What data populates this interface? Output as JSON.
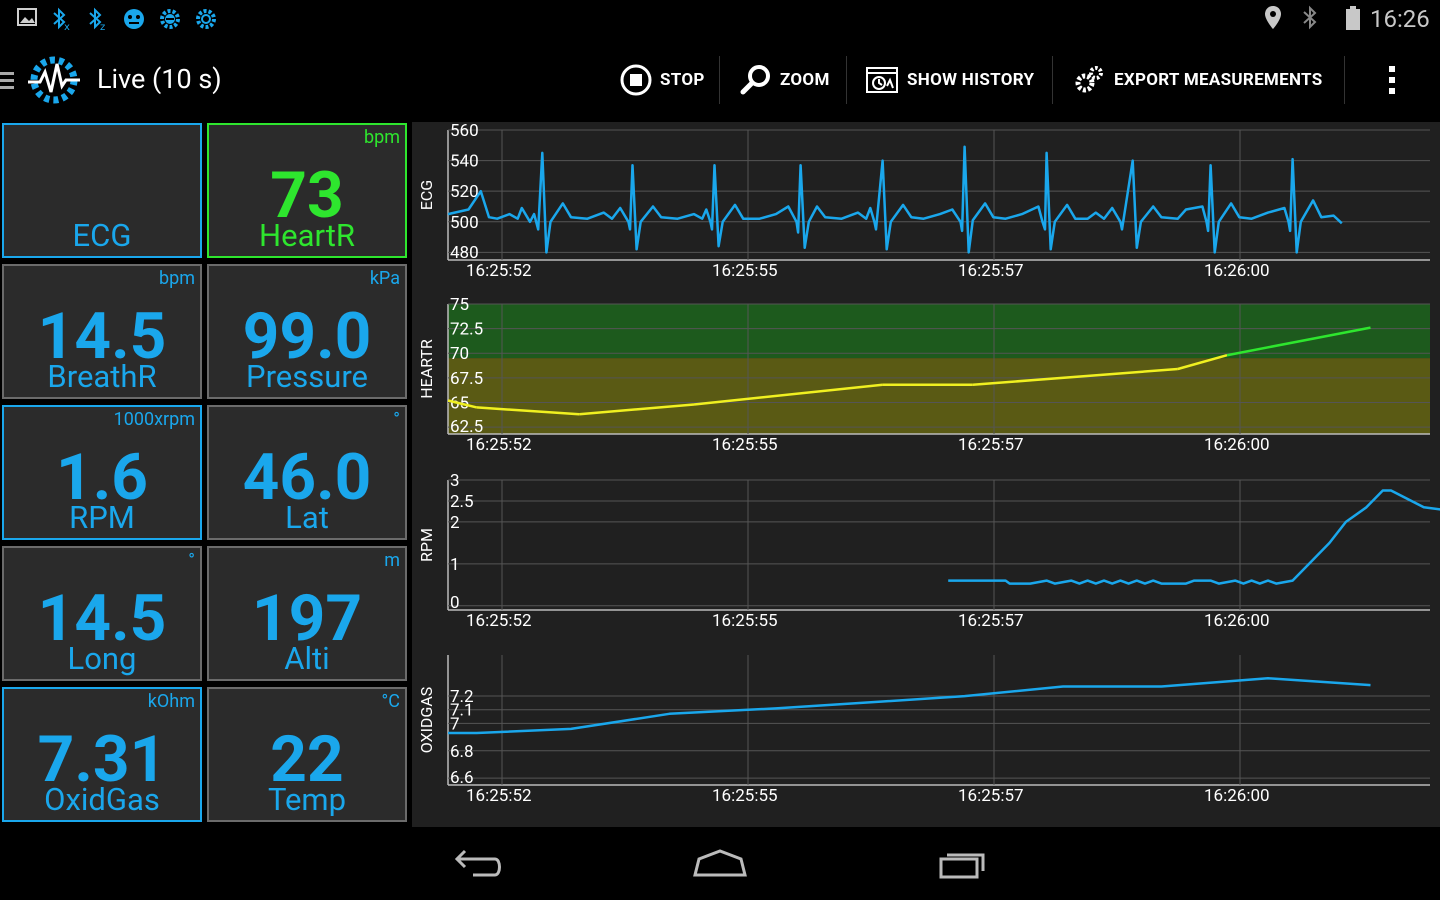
{
  "status_bar": {
    "left_icons": [
      "image-icon",
      "bluetooth-x-icon",
      "bluetooth-z-icon",
      "face-icon",
      "gear-badge-icon",
      "gear-icon"
    ],
    "right_icons": [
      "location-icon",
      "bluetooth-icon",
      "battery-icon"
    ],
    "time": "16:26"
  },
  "action_bar": {
    "title": "Live (10 s)",
    "buttons": {
      "stop": "STOP",
      "zoom": "ZOOM",
      "history": "SHOW HISTORY",
      "export": "EXPORT MEASUREMENTS"
    }
  },
  "tiles": [
    {
      "name": "ECG",
      "value": "",
      "unit": "",
      "style": "blue"
    },
    {
      "name": "HeartR",
      "value": "73",
      "unit": "bpm",
      "style": "green"
    },
    {
      "name": "BreathR",
      "value": "14.5",
      "unit": "bpm",
      "style": "gray"
    },
    {
      "name": "Pressure",
      "value": "99.0",
      "unit": "kPa",
      "style": "gray"
    },
    {
      "name": "RPM",
      "value": "1.6",
      "unit": "1000xrpm",
      "style": "blue"
    },
    {
      "name": "Lat",
      "value": "46.0",
      "unit": "°",
      "style": "gray"
    },
    {
      "name": "Long",
      "value": "14.5",
      "unit": "°",
      "style": "gray"
    },
    {
      "name": "Alti",
      "value": "197",
      "unit": "m",
      "style": "gray"
    },
    {
      "name": "OxidGas",
      "value": "7.31",
      "unit": "kOhm",
      "style": "blue"
    },
    {
      "name": "Temp",
      "value": "22",
      "unit": "°C",
      "style": "gray"
    }
  ],
  "colors": {
    "accent_blue": "#1aa7ec",
    "accent_green": "#2ee62e",
    "trace_yellow": "#f0f020",
    "zone_green": "#1d5a1d",
    "zone_yellow": "#5a5a14"
  },
  "chart_data": [
    {
      "type": "line",
      "ylabel": "ECG",
      "x_ticks": [
        "16:25:52",
        "16:25:55",
        "16:25:57",
        "16:26:00"
      ],
      "y_ticks": [
        "480",
        "500",
        "520",
        "540",
        "560"
      ],
      "ylim": [
        475,
        560
      ],
      "series": [
        {
          "values": [
            [
              0,
              505
            ],
            [
              0.25,
              508
            ],
            [
              0.4,
              520
            ],
            [
              0.5,
              503
            ],
            [
              0.6,
              502
            ],
            [
              0.75,
              505
            ],
            [
              0.85,
              502
            ],
            [
              0.9,
              509
            ],
            [
              1.0,
              500
            ],
            [
              1.05,
              505
            ],
            [
              1.1,
              495
            ],
            [
              1.15,
              545
            ],
            [
              1.2,
              480
            ],
            [
              1.25,
              500
            ],
            [
              1.4,
              512
            ],
            [
              1.5,
              503
            ],
            [
              1.7,
              502
            ],
            [
              1.9,
              506
            ],
            [
              2.0,
              502
            ],
            [
              2.1,
              509
            ],
            [
              2.2,
              500
            ],
            [
              2.22,
              495
            ],
            [
              2.25,
              537
            ],
            [
              2.3,
              482
            ],
            [
              2.35,
              500
            ],
            [
              2.5,
              510
            ],
            [
              2.6,
              503
            ],
            [
              2.8,
              502
            ],
            [
              3.0,
              505
            ],
            [
              3.1,
              502
            ],
            [
              3.15,
              508
            ],
            [
              3.2,
              500
            ],
            [
              3.22,
              495
            ],
            [
              3.25,
              537
            ],
            [
              3.3,
              484
            ],
            [
              3.35,
              500
            ],
            [
              3.5,
              511
            ],
            [
              3.6,
              502
            ],
            [
              3.8,
              502
            ],
            [
              4.0,
              505
            ],
            [
              4.15,
              510
            ],
            [
              4.25,
              500
            ],
            [
              4.27,
              493
            ],
            [
              4.3,
              537
            ],
            [
              4.35,
              483
            ],
            [
              4.4,
              500
            ],
            [
              4.5,
              510
            ],
            [
              4.6,
              503
            ],
            [
              4.8,
              502
            ],
            [
              5.0,
              506
            ],
            [
              5.1,
              502
            ],
            [
              5.15,
              509
            ],
            [
              5.2,
              500
            ],
            [
              5.22,
              495
            ],
            [
              5.3,
              540
            ],
            [
              5.35,
              482
            ],
            [
              5.4,
              500
            ],
            [
              5.55,
              511
            ],
            [
              5.65,
              503
            ],
            [
              5.8,
              502
            ],
            [
              6.0,
              505
            ],
            [
              6.15,
              508
            ],
            [
              6.25,
              500
            ],
            [
              6.27,
              494
            ],
            [
              6.3,
              549
            ],
            [
              6.35,
              480
            ],
            [
              6.4,
              501
            ],
            [
              6.55,
              512
            ],
            [
              6.65,
              503
            ],
            [
              6.8,
              502
            ],
            [
              7.0,
              505
            ],
            [
              7.2,
              510
            ],
            [
              7.25,
              500
            ],
            [
              7.28,
              495
            ],
            [
              7.3,
              545
            ],
            [
              7.35,
              482
            ],
            [
              7.4,
              500
            ],
            [
              7.55,
              511
            ],
            [
              7.65,
              502
            ],
            [
              7.8,
              502
            ],
            [
              7.9,
              506
            ],
            [
              8.0,
              502
            ],
            [
              8.1,
              509
            ],
            [
              8.2,
              500
            ],
            [
              8.22,
              495
            ],
            [
              8.35,
              540
            ],
            [
              8.4,
              483
            ],
            [
              8.45,
              500
            ],
            [
              8.6,
              510
            ],
            [
              8.7,
              503
            ],
            [
              8.9,
              502
            ],
            [
              9.0,
              508
            ],
            [
              9.2,
              510
            ],
            [
              9.25,
              500
            ],
            [
              9.27,
              494
            ],
            [
              9.3,
              537
            ],
            [
              9.35,
              480
            ],
            [
              9.4,
              500
            ],
            [
              9.55,
              512
            ],
            [
              9.65,
              503
            ],
            [
              9.8,
              502
            ],
            [
              10.0,
              506
            ],
            [
              10.2,
              509
            ],
            [
              10.25,
              500
            ],
            [
              10.27,
              494
            ],
            [
              10.3,
              541
            ],
            [
              10.35,
              480
            ],
            [
              10.4,
              500
            ],
            [
              10.55,
              514
            ],
            [
              10.65,
              503
            ],
            [
              10.8,
              504
            ],
            [
              10.9,
              499
            ]
          ]
        }
      ]
    },
    {
      "type": "line",
      "ylabel": "HEARTR",
      "x_ticks": [
        "16:25:52",
        "16:25:55",
        "16:25:57",
        "16:26:00"
      ],
      "y_ticks": [
        "62.5",
        "65",
        "67.5",
        "70",
        "72.5",
        "75"
      ],
      "ylim": [
        61.8,
        75
      ],
      "zones": [
        {
          "from": 69.5,
          "to": 75,
          "color": "green"
        },
        {
          "from": 61.8,
          "to": 69.5,
          "color": "yellow"
        }
      ],
      "series": [
        {
          "values": [
            [
              0,
              65.2
            ],
            [
              0.35,
              64.5
            ],
            [
              1.6,
              63.8
            ],
            [
              3.0,
              64.8
            ],
            [
              5.3,
              66.8
            ],
            [
              6.4,
              66.8
            ],
            [
              8.9,
              68.4
            ],
            [
              9.5,
              69.8
            ],
            [
              11.25,
              72.6
            ]
          ]
        }
      ]
    },
    {
      "type": "line",
      "ylabel": "RPM",
      "x_ticks": [
        "16:25:52",
        "16:25:55",
        "16:25:57",
        "16:26:00"
      ],
      "y_ticks": [
        "0",
        "1",
        "2",
        "2.5",
        "3"
      ],
      "ylim": [
        -0.1,
        3
      ],
      "series": [
        {
          "values": [
            [
              6.1,
              0.6
            ],
            [
              6.4,
              0.6
            ],
            [
              6.8,
              0.6
            ],
            [
              6.85,
              0.53
            ],
            [
              7.1,
              0.53
            ],
            [
              7.3,
              0.6
            ],
            [
              7.4,
              0.53
            ],
            [
              7.6,
              0.6
            ],
            [
              7.7,
              0.53
            ],
            [
              7.8,
              0.6
            ],
            [
              7.9,
              0.53
            ],
            [
              8.0,
              0.6
            ],
            [
              8.1,
              0.53
            ],
            [
              8.2,
              0.6
            ],
            [
              8.3,
              0.53
            ],
            [
              8.4,
              0.6
            ],
            [
              8.5,
              0.53
            ],
            [
              8.6,
              0.6
            ],
            [
              8.7,
              0.53
            ],
            [
              9.0,
              0.53
            ],
            [
              9.1,
              0.6
            ],
            [
              9.3,
              0.6
            ],
            [
              9.4,
              0.53
            ],
            [
              9.6,
              0.6
            ],
            [
              9.7,
              0.53
            ],
            [
              9.8,
              0.6
            ],
            [
              9.9,
              0.53
            ],
            [
              10.0,
              0.6
            ],
            [
              10.1,
              0.53
            ],
            [
              10.3,
              0.6
            ],
            [
              10.5,
              1.0
            ],
            [
              10.75,
              1.5
            ],
            [
              10.95,
              2.0
            ],
            [
              11.2,
              2.35
            ],
            [
              11.4,
              2.75
            ],
            [
              11.5,
              2.75
            ],
            [
              11.7,
              2.55
            ],
            [
              11.9,
              2.35
            ],
            [
              12.1,
              2.3
            ],
            [
              12.3,
              2.1
            ],
            [
              12.5,
              2.0
            ],
            [
              12.65,
              1.8
            ]
          ]
        }
      ]
    },
    {
      "type": "line",
      "ylabel": "OXIDGAS",
      "x_ticks": [
        "16:25:52",
        "16:25:55",
        "16:25:57",
        "16:26:00"
      ],
      "y_ticks": [
        "6.6",
        "6.8",
        "7",
        "7.1",
        "7.2"
      ],
      "ylim": [
        6.55,
        7.5
      ],
      "series": [
        {
          "values": [
            [
              0,
              6.93
            ],
            [
              0.35,
              6.93
            ],
            [
              1.5,
              6.96
            ],
            [
              2.7,
              7.07
            ],
            [
              4.0,
              7.11
            ],
            [
              5.3,
              7.16
            ],
            [
              6.3,
              7.2
            ],
            [
              7.5,
              7.27
            ],
            [
              8.7,
              7.27
            ],
            [
              10.0,
              7.33
            ],
            [
              11.25,
              7.28
            ]
          ]
        }
      ]
    }
  ]
}
